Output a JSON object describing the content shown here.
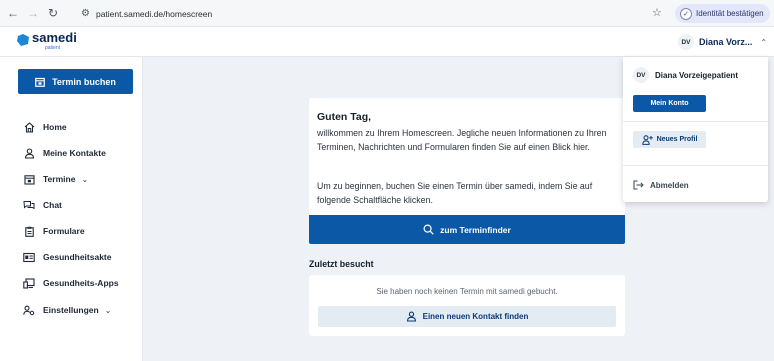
{
  "browser": {
    "url": "patient.samedi.de/homescreen",
    "verify_label": "Identität bestätigen"
  },
  "header": {
    "logo_text": "samedi",
    "logo_sub": "patient",
    "user_initials": "DV",
    "user_name_short": "Diana Vorz..."
  },
  "sidebar": {
    "book_label": "Termin buchen",
    "items": [
      {
        "label": "Home"
      },
      {
        "label": "Meine Kontakte"
      },
      {
        "label": "Termine"
      },
      {
        "label": "Chat"
      },
      {
        "label": "Formulare"
      },
      {
        "label": "Gesundheitsakte"
      },
      {
        "label": "Gesundheits-Apps"
      },
      {
        "label": "Einstellungen"
      }
    ]
  },
  "main": {
    "greeting": "Guten Tag,",
    "intro": "willkommen zu Ihrem Homescreen. Jegliche neuen Informationen zu Ihren Terminen, Nachrichten und Formularen finden Sie auf einen Blick hier.",
    "instruction": "Um zu beginnen, buchen Sie einen Termin über samedi, indem Sie auf folgende Schaltfläche klicken.",
    "finder_label": "zum Terminfinder",
    "recent_title": "Zuletzt besucht",
    "recent_empty": "Sie haben noch keinen Termin mit samedi gebucht.",
    "contact_label": "Einen neuen Kontakt finden"
  },
  "dropdown": {
    "initials": "DV",
    "full_name": "Diana Vorzeigepatient",
    "account_label": "Mein Konto",
    "new_profile_label": "Neues Profil",
    "logout_label": "Abmelden"
  },
  "colors": {
    "primary": "#0b59a6",
    "secondary_bg": "#e3ebf3",
    "page_bg": "#eef1f5"
  }
}
